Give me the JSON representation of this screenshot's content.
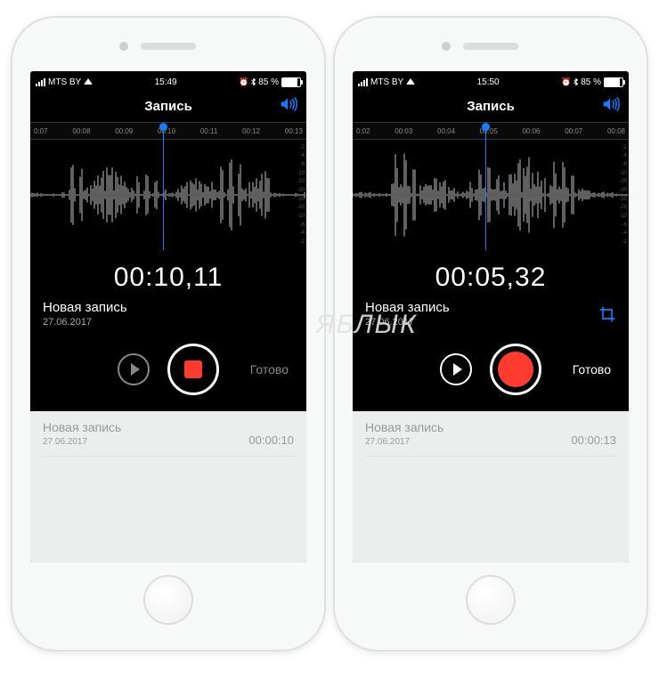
{
  "phones": [
    {
      "status": {
        "carrier": "MTS BY",
        "time": "15:49",
        "battery_pct": "85 %"
      },
      "nav_title": "Запись",
      "ruler": [
        "0:07",
        "00:08",
        "00:09",
        "00:10",
        "00:11",
        "00:12",
        "00:13"
      ],
      "playhead_pct": 48,
      "timer": "00:10,11",
      "rec_title": "Новая запись",
      "rec_date": "27.06.2017",
      "has_crop": false,
      "play_enabled": false,
      "rec_mode": "stop",
      "done_label": "Готово",
      "done_enabled": false,
      "list_item": {
        "title": "Новая запись",
        "date": "27.06.2017",
        "dur": "00:00:10"
      },
      "arrow_target": "stop"
    },
    {
      "status": {
        "carrier": "MTS BY",
        "time": "15:50",
        "battery_pct": "85 %"
      },
      "nav_title": "Запись",
      "ruler": [
        "0:02",
        "00:03",
        "00:04",
        "00:05",
        "00:06",
        "00:07",
        "00:08"
      ],
      "playhead_pct": 48,
      "timer": "00:05,32",
      "rec_title": "Новая запись",
      "rec_date": "27.06.2017",
      "has_crop": true,
      "play_enabled": true,
      "rec_mode": "record",
      "done_label": "Готово",
      "done_enabled": true,
      "list_item": {
        "title": "Новая запись",
        "date": "27.06.2017",
        "dur": "00:00:13"
      },
      "arrow_target": "done"
    }
  ],
  "db_scale": [
    "-2",
    "-4",
    "-6",
    "-10",
    "-20",
    "-30",
    "-30",
    "-20",
    "-10",
    "-6",
    "-4",
    "-2"
  ],
  "watermark": "ЯБЛЫК"
}
